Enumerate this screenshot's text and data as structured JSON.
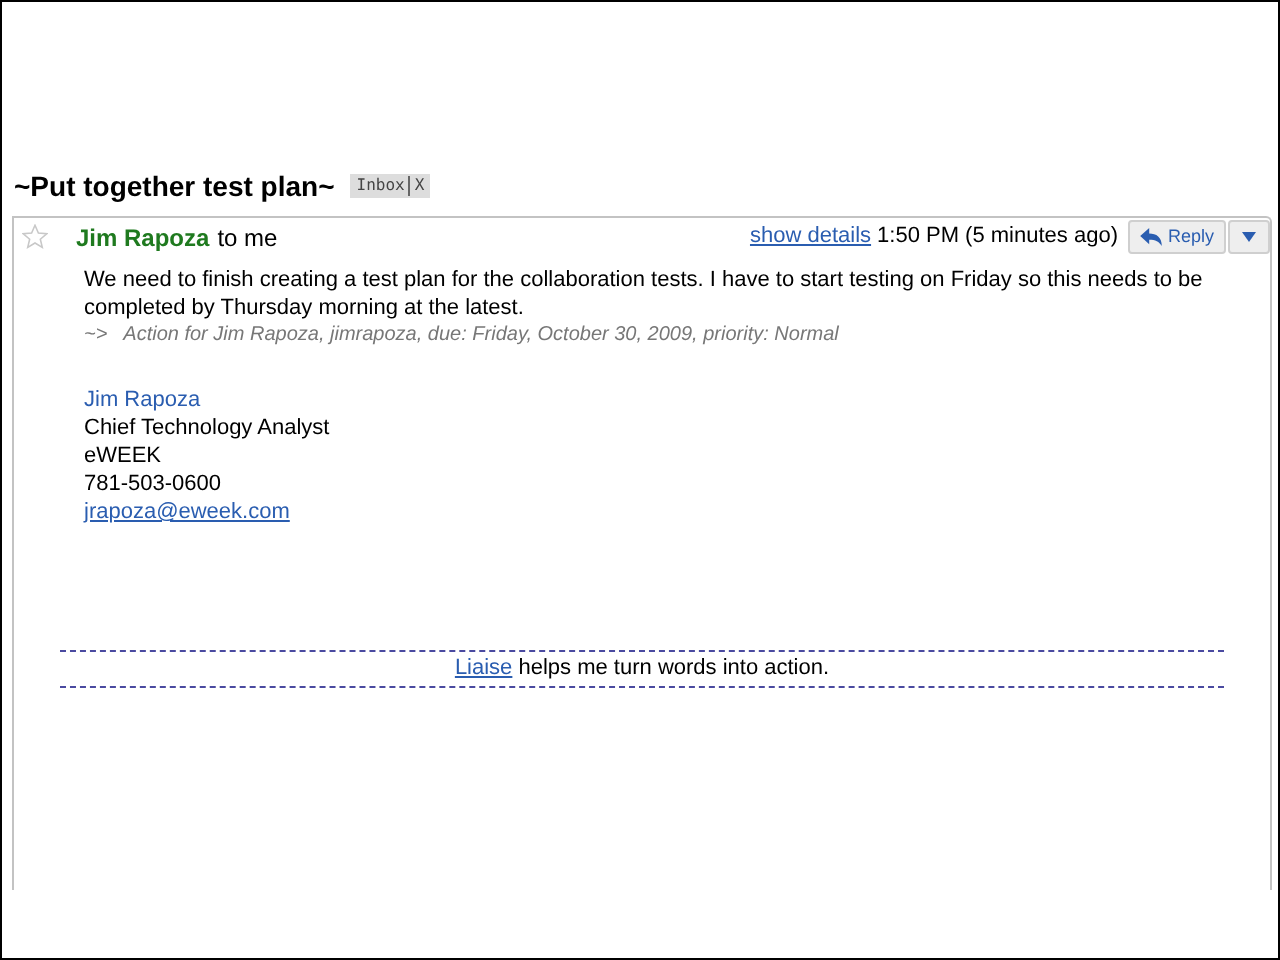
{
  "subject": "~Put together test plan~",
  "labels": [
    {
      "text": "Inbox",
      "remove": "X"
    }
  ],
  "message": {
    "starred": false,
    "sender": "Jim Rapoza",
    "recipient": "to me",
    "details_link": "show details",
    "time": "1:50 PM (5 minutes ago)",
    "reply": "Reply",
    "body": "We need to finish creating a test plan for the collaboration tests. I have to start testing on Friday so this needs to be completed by Thursday morning at the latest.",
    "action_note": "~>   Action for Jim Rapoza, jimrapoza, due: Friday, October 30, 2009, priority: Normal",
    "signature": [
      {
        "kind": "name",
        "text": "Jim Rapoza"
      },
      {
        "kind": "text",
        "text": "Chief Technology Analyst"
      },
      {
        "kind": "text",
        "text": "eWEEK"
      },
      {
        "kind": "text",
        "text": "781-503-0600"
      },
      {
        "kind": "link",
        "text": "jrapoza@eweek.com"
      }
    ],
    "footer": {
      "link": "Liaise",
      "text": "helps me turn words into action."
    }
  }
}
